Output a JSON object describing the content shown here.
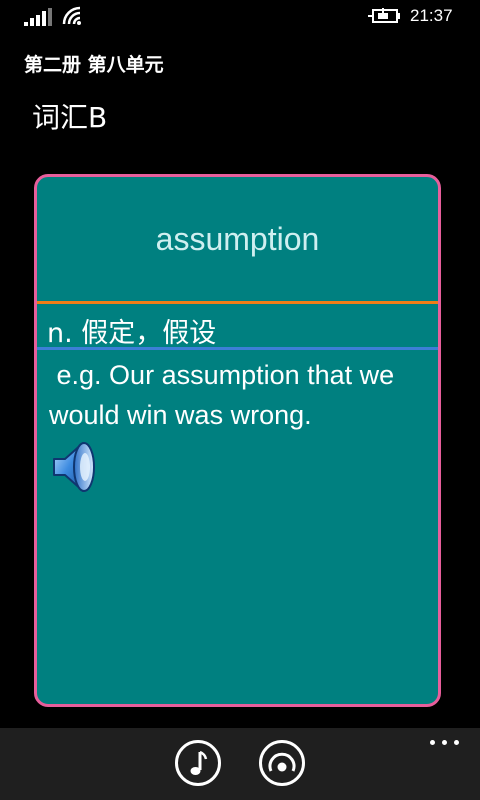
{
  "status_bar": {
    "time": "21:37",
    "icons": [
      "signal-icon",
      "wifi-icon",
      "battery-charging-icon"
    ]
  },
  "header": {
    "app_title": "第二册 第八单元",
    "page_title": "词汇B"
  },
  "card": {
    "word": "assumption",
    "definition": "n. 假定，假设",
    "example": " e.g. Our assumption that we would win was wrong.",
    "speaker_icon": "speaker-icon",
    "colors": {
      "background": "#008080",
      "border": "#e75e9b",
      "word_separator": "#f07d16",
      "definition_separator": "#3d7fd6"
    }
  },
  "app_bar": {
    "buttons": [
      "music-note-icon",
      "record-icon"
    ],
    "more_icon": "more-icon"
  }
}
